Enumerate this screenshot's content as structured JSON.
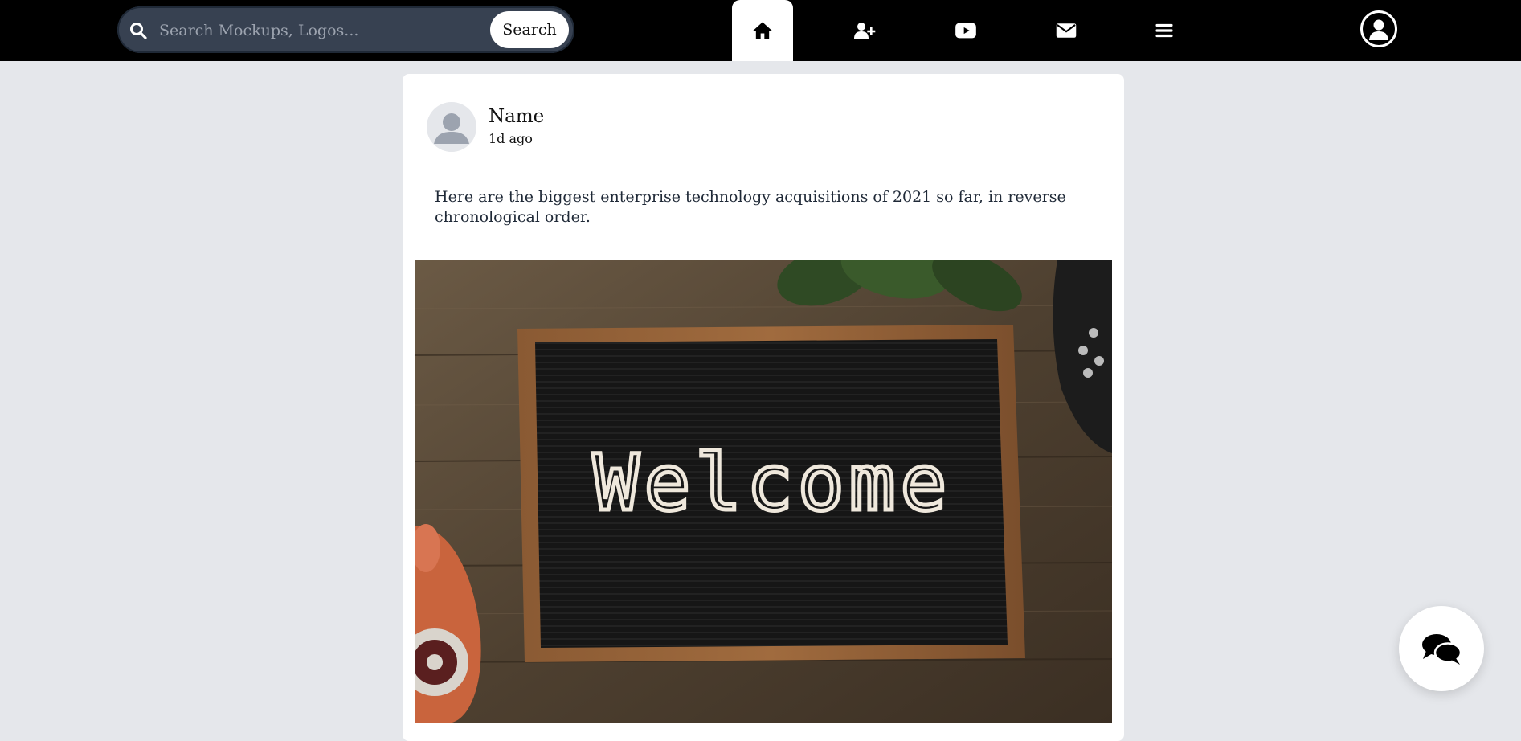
{
  "search": {
    "placeholder": "Search Mockups, Logos...",
    "button_label": "Search"
  },
  "nav": {
    "tabs": [
      {
        "icon": "home-icon",
        "active": true
      },
      {
        "icon": "user-plus-icon",
        "active": false
      },
      {
        "icon": "youtube-icon",
        "active": false
      },
      {
        "icon": "envelope-icon",
        "active": false
      },
      {
        "icon": "menu-icon",
        "active": false
      }
    ],
    "profile_icon": "user-circle-icon"
  },
  "post": {
    "author_name": "Name",
    "time": "1d ago",
    "text": "Here are the biggest enterprise technology acquisitions of 2021 so far, in reverse chronological order.",
    "image_text": "Welcome"
  },
  "fab": {
    "icon": "chat-icon"
  },
  "colors": {
    "topbar": "#000000",
    "search_bg": "#374151",
    "page_bg": "#e5e7eb",
    "card_bg": "#ffffff"
  }
}
